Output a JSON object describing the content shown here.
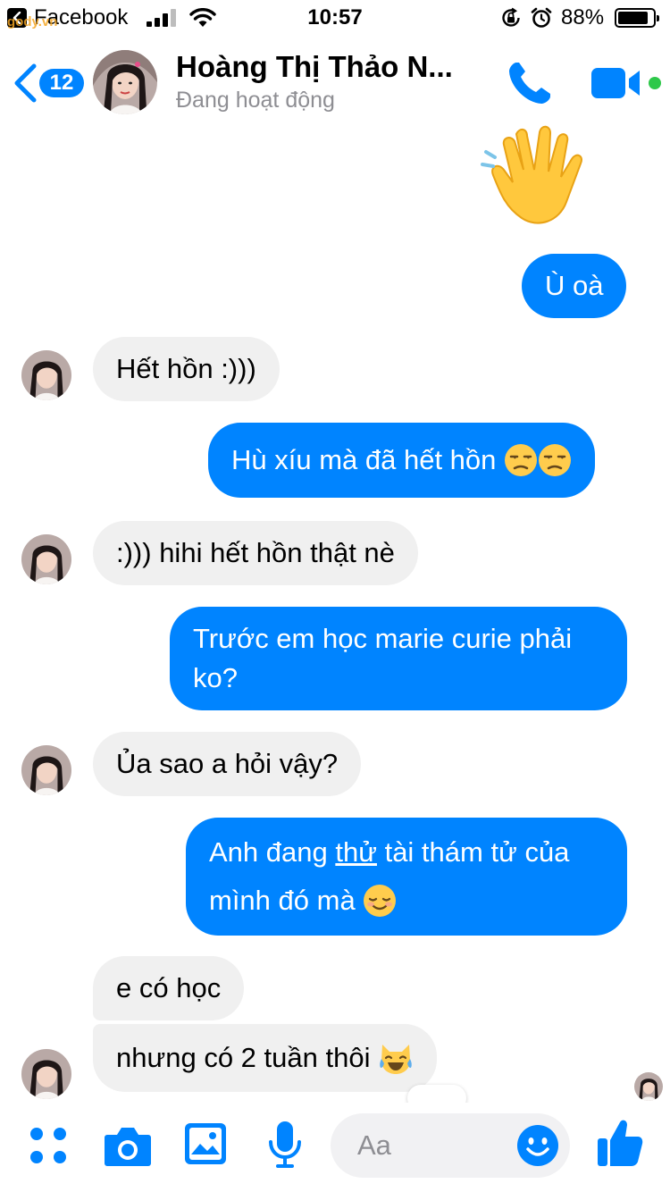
{
  "status_bar": {
    "app_back_label": "Facebook",
    "watermark": "gody.vn",
    "time": "10:57",
    "battery_percent": "88%",
    "battery_level": 0.88
  },
  "header": {
    "unread_count": "12",
    "contact_name": "Hoàng Thị Thảo N...",
    "contact_status": "Đang hoạt động",
    "accent_color": "#0084ff",
    "online_color": "#2ec84a"
  },
  "messages": [
    {
      "direction": "out",
      "kind": "emoji-sticker",
      "icon": "waving-hand-icon"
    },
    {
      "direction": "out",
      "text": "Ù oà"
    },
    {
      "direction": "in",
      "text": "Hết hồn :)))"
    },
    {
      "direction": "out",
      "text": "Hù xíu mà đã hết hồn",
      "emoji": [
        "unamused-face-icon",
        "unamused-face-icon"
      ]
    },
    {
      "direction": "in",
      "text": ":))) hihi hết hồn thật nè"
    },
    {
      "direction": "out",
      "lines": [
        "Trước em học marie curie phải",
        "ko?"
      ]
    },
    {
      "direction": "in",
      "text": "Ủa sao a hỏi vậy?"
    },
    {
      "direction": "out",
      "line1_before": "Anh đang ",
      "line1_underlined": "thử",
      "line1_after": " tài thám tử của",
      "line2": "mình đó mà",
      "emoji": [
        "relieved-face-icon"
      ]
    },
    {
      "direction": "in",
      "text": "e có học"
    },
    {
      "direction": "in",
      "text": "nhưng có 2 tuần thôi",
      "emoji": [
        "cat-tears-of-joy-icon"
      ]
    }
  ],
  "composer": {
    "placeholder": "Aa",
    "icons": [
      "menu-dots-icon",
      "camera-icon",
      "photo-icon",
      "microphone-icon",
      "emoji-smile-icon",
      "thumbs-up-icon"
    ]
  }
}
